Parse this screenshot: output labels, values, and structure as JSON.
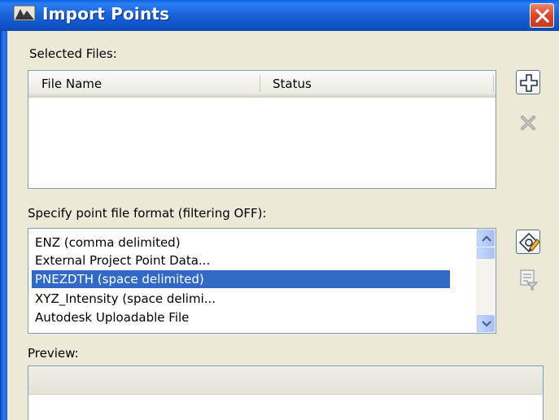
{
  "window": {
    "title": "Import Points",
    "close_icon": "close-icon"
  },
  "selected_files": {
    "label": "Selected Files:",
    "columns": [
      "File Name",
      "Status"
    ],
    "rows": [],
    "add_icon": "add-file-icon",
    "remove_icon": "remove-file-icon"
  },
  "format": {
    "label": "Specify point file format (filtering OFF):",
    "items": [
      "ENZ (comma delimited)",
      "External Project Point Data...",
      "PNEZDTH (space delimited)",
      "XYZ_Intensity (space delimi...",
      "Autodesk Uploadable File"
    ],
    "selected_index": 2,
    "edit_icon": "edit-format-icon",
    "filter_icon": "filter-format-icon"
  },
  "preview": {
    "label": "Preview:"
  },
  "colors": {
    "titlebar": "#0f55c9",
    "selection": "#316ac5",
    "dialog_bg": "#ece9d8"
  }
}
